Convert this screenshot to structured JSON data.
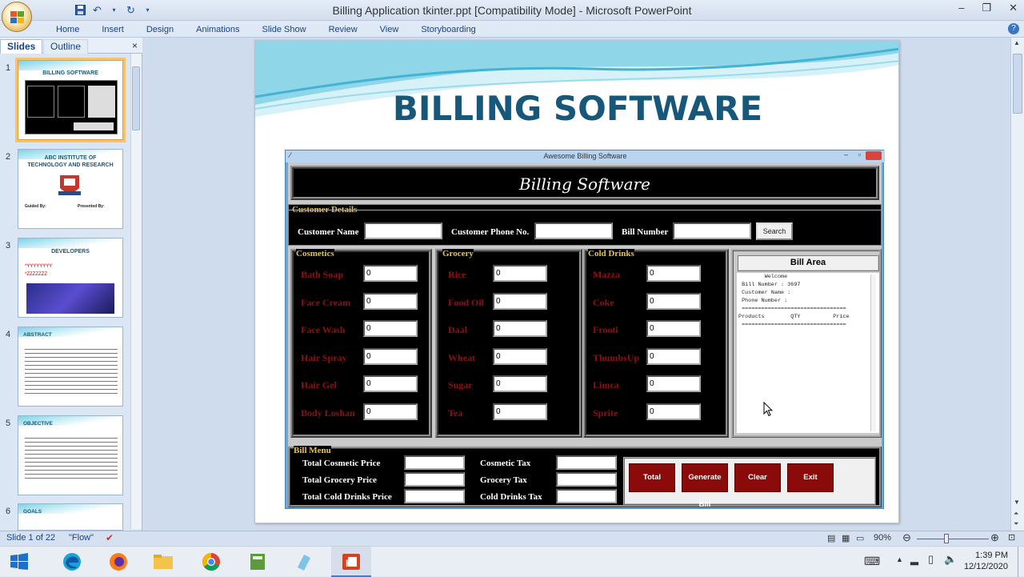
{
  "window": {
    "title": "Billing Application tkinter.ppt [Compatibility Mode] - Microsoft PowerPoint",
    "controls": [
      "–",
      "❐",
      "✕"
    ]
  },
  "ribbon": {
    "tabs": [
      "Home",
      "Insert",
      "Design",
      "Animations",
      "Slide Show",
      "Review",
      "View",
      "Storyboarding"
    ],
    "help": "?"
  },
  "panel": {
    "tabs": {
      "slides": "Slides",
      "outline": "Outline"
    },
    "close": "×",
    "thumbs": [
      {
        "num": "1",
        "title": "BILLING SOFTWARE"
      },
      {
        "num": "2",
        "title": "ABC INSTITUTE OF TECHNOLOGY AND RESEARCH",
        "guided": "Guided By:",
        "presented": "Presented By:"
      },
      {
        "num": "3",
        "title": "DEVELOPERS",
        "lines": [
          "*YYYYYYYY",
          "*ZZZZZZZ"
        ]
      },
      {
        "num": "4",
        "title": "ABSTRACT"
      },
      {
        "num": "5",
        "title": "OBJECTIVE"
      },
      {
        "num": "6",
        "title": "GOALS"
      }
    ]
  },
  "slide": {
    "title": "BILLING SOFTWARE"
  },
  "app": {
    "window_title": "Awesome Billing Software",
    "header": "Billing Software",
    "customer": {
      "legend": "Customer Details",
      "name_label": "Customer Name",
      "phone_label": "Customer Phone No.",
      "bill_label": "Bill Number",
      "search": "Search",
      "name_value": "",
      "phone_value": "",
      "bill_value": ""
    },
    "cosmetics": {
      "legend": "Cosmetics",
      "items": [
        {
          "label": "Bath Soap",
          "value": "0"
        },
        {
          "label": "Face Cream",
          "value": "0"
        },
        {
          "label": "Face Wash",
          "value": "0"
        },
        {
          "label": "Hair Spray",
          "value": "0"
        },
        {
          "label": "Hair Gel",
          "value": "0"
        },
        {
          "label": "Body Loshan",
          "value": "0"
        }
      ]
    },
    "grocery": {
      "legend": "Grocery",
      "items": [
        {
          "label": "Rice",
          "value": "0"
        },
        {
          "label": "Food Oil",
          "value": "0"
        },
        {
          "label": "Daal",
          "value": "0"
        },
        {
          "label": "Wheat",
          "value": "0"
        },
        {
          "label": "Sugar",
          "value": "0"
        },
        {
          "label": "Tea",
          "value": "0"
        }
      ]
    },
    "drinks": {
      "legend": "Cold Drinks",
      "items": [
        {
          "label": "Mazza",
          "value": "0"
        },
        {
          "label": "Coke",
          "value": "0"
        },
        {
          "label": "Frooti",
          "value": "0"
        },
        {
          "label": "ThumbsUp",
          "value": "0"
        },
        {
          "label": "Limca",
          "value": "0"
        },
        {
          "label": "Sprite",
          "value": "0"
        }
      ]
    },
    "bill_area": {
      "title": "Bill Area",
      "text": "        Welcome\n Bill Number : 3697\n Customer Name :\n Phone Number :\n ================================\nProducts        QTY          Price\n ================================"
    },
    "bill_menu": {
      "legend": "Bill Menu",
      "prices": [
        {
          "label": "Total Cosmetic Price",
          "value": ""
        },
        {
          "label": "Total Grocery Price",
          "value": ""
        },
        {
          "label": "Total Cold Drinks Price",
          "value": ""
        }
      ],
      "taxes": [
        {
          "label": "Cosmetic Tax",
          "value": ""
        },
        {
          "label": "Grocery Tax",
          "value": ""
        },
        {
          "label": "Cold Drinks Tax",
          "value": ""
        }
      ],
      "buttons": [
        "Total",
        "Generate Bill",
        "Clear",
        "Exit"
      ]
    }
  },
  "status": {
    "slide": "Slide 1 of 22",
    "theme": "\"Flow\"",
    "zoom": "90%"
  },
  "taskbar": {
    "time": "1:39 PM",
    "date": "12/12/2020"
  },
  "colors": {
    "slide_title": "#17577a",
    "app_header_bg": "#000000",
    "item_label": "#8b1212",
    "legend": "#e8c14a",
    "action_button": "#8b0a0a"
  }
}
